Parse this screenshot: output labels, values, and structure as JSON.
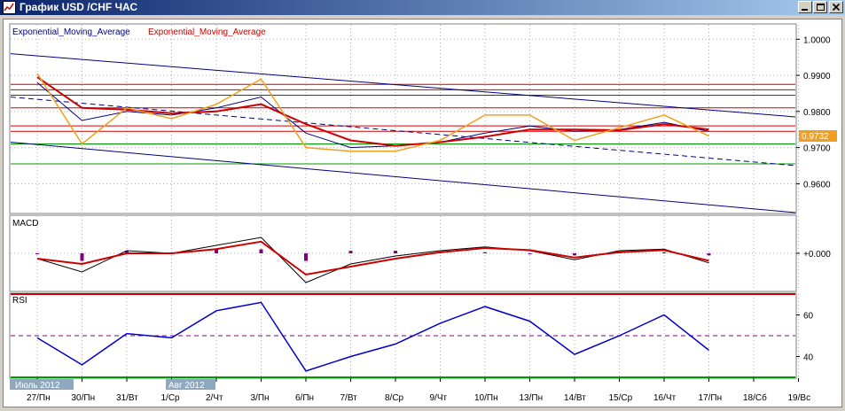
{
  "window": {
    "title": "График USD /CHF ЧАС"
  },
  "panels": {
    "main": {
      "legend_1": "Exponential_Moving_Average",
      "legend_2": "Exponential_Moving_Average",
      "price_label": "0.9732"
    },
    "macd": {
      "label": "MACD"
    },
    "rsi": {
      "label": "RSI"
    }
  },
  "month_labels": [
    "Июль 2012",
    "Авг 2012"
  ],
  "colors": {
    "price": "#f0a020",
    "ema_fast": "#000080",
    "ema_slow": "#cc0000",
    "rsi": "#0000cc",
    "trend_channel": "#000080",
    "support": "#009900",
    "resistance": "#cc0000",
    "histogram": "#800080"
  },
  "chart_data": [
    {
      "type": "line",
      "panel": "main",
      "title": "",
      "x": [
        "27/Пн",
        "30/Пн",
        "31/Вт",
        "1/Ср",
        "2/Чт",
        "3/Пн",
        "6/Пн",
        "7/Вт",
        "8/Ср",
        "9/Чт",
        "10/Пн",
        "13/Пн",
        "14/Вт",
        "15/Ср",
        "16/Чт",
        "17/Пн",
        "18/Сб",
        "19/Вс"
      ],
      "ylim": [
        0.952,
        1.004
      ],
      "yticks": [
        "1.0000",
        "0.9900",
        "0.9800",
        "0.9700",
        "0.9600"
      ],
      "grid": true,
      "series": [
        {
          "name": "Exponential_Moving_Average",
          "values": [
            0.988,
            0.9775,
            0.98,
            0.979,
            0.981,
            0.984,
            0.974,
            0.97,
            0.9705,
            0.9715,
            0.974,
            0.976,
            0.9745,
            0.975,
            0.977,
            0.9745,
            null,
            null
          ]
        },
        {
          "name": "Exponential_Moving_Average",
          "values": [
            0.9895,
            0.981,
            0.9805,
            0.9795,
            0.98,
            0.982,
            0.9765,
            0.972,
            0.9705,
            0.9715,
            0.973,
            0.975,
            0.975,
            0.9748,
            0.9765,
            0.975,
            null,
            null
          ]
        },
        {
          "name": "",
          "values": [
            0.9905,
            0.971,
            0.981,
            0.978,
            0.982,
            0.989,
            0.97,
            0.969,
            0.969,
            0.972,
            0.979,
            0.979,
            0.972,
            0.9755,
            0.979,
            0.9732,
            null,
            null
          ]
        }
      ],
      "horizontal_levels": [
        0.9875,
        0.986,
        0.9845,
        0.981,
        0.976,
        0.9745,
        0.971,
        0.9655
      ],
      "last_value": 0.9732
    },
    {
      "type": "line",
      "panel": "macd",
      "title": "",
      "ylabel_ticks": [
        "+0.000"
      ],
      "x": [
        "27/Пн",
        "30/Пн",
        "31/Вт",
        "1/Ср",
        "2/Чт",
        "3/Пн",
        "6/Пн",
        "7/Вт",
        "8/Ср",
        "9/Чт",
        "10/Пн",
        "13/Пн",
        "14/Вт",
        "15/Ср",
        "16/Чт",
        "17/Пн"
      ],
      "series": [
        {
          "name": "",
          "values": [
            -0.001,
            -0.0035,
            0.0005,
            0.0,
            0.0015,
            0.003,
            -0.0055,
            -0.002,
            -0.0005,
            0.0005,
            0.0012,
            0.0005,
            -0.0012,
            0.0005,
            0.0008,
            -0.0018
          ]
        },
        {
          "name": "",
          "values": [
            -0.001,
            -0.002,
            0.0,
            0.0,
            0.0008,
            0.0022,
            -0.004,
            -0.0025,
            -0.001,
            0.0002,
            0.001,
            0.0006,
            -0.0008,
            0.0002,
            0.0006,
            -0.0014
          ]
        }
      ]
    },
    {
      "type": "line",
      "panel": "rsi",
      "title": "",
      "ylim": [
        30,
        70
      ],
      "yticks": [
        "60",
        "40"
      ],
      "levels": [
        70,
        50,
        30
      ],
      "x": [
        "27/Пн",
        "30/Пн",
        "31/Вт",
        "1/Ср",
        "2/Чт",
        "3/Пн",
        "6/Пн",
        "7/Вт",
        "8/Ср",
        "9/Чт",
        "10/Пн",
        "13/Пн",
        "14/Вт",
        "15/Ср",
        "16/Чт",
        "17/Пн"
      ],
      "series": [
        {
          "name": "",
          "values": [
            49,
            36,
            51,
            49,
            62,
            66,
            33,
            40,
            46,
            56,
            64,
            57,
            41,
            50,
            60,
            43
          ]
        }
      ]
    }
  ]
}
